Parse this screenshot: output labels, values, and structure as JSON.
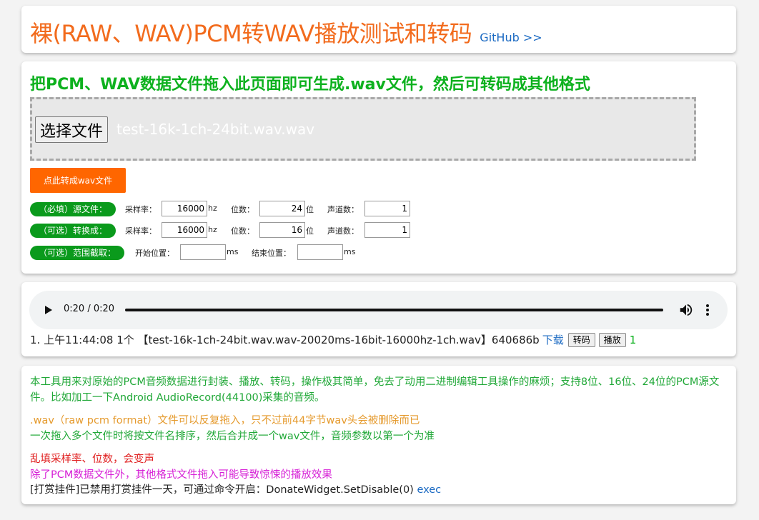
{
  "header": {
    "title": "裸(RAW、WAV)PCM转WAV播放测试和转码",
    "github_link": "GitHub >>"
  },
  "dropzone": {
    "heading": "把PCM、WAV数据文件拖入此页面即可生成.wav文件，然后可转码成其他格式",
    "file_button_label": "选择文件",
    "file_name": "test-16k-1ch-24bit.wav.wav"
  },
  "convert_button_label": "点此转成wav文件",
  "params": {
    "source": {
      "label": "（必填）源文件：",
      "sample_rate_label": "采样率：",
      "sample_rate": "16000",
      "hz": "hz",
      "bits_label": "位数：",
      "bits": "24",
      "bits_unit": "位",
      "channels_label": "声道数：",
      "channels": "1"
    },
    "target": {
      "label": "（可选）转换成：",
      "sample_rate_label": "采样率：",
      "sample_rate": "16000",
      "hz": "hz",
      "bits_label": "位数：",
      "bits": "16",
      "bits_unit": "位",
      "channels_label": "声道数：",
      "channels": "1"
    },
    "range": {
      "label": "（可选）范围截取：",
      "start_label": "开始位置：",
      "start": "",
      "start_unit": "ms",
      "end_label": "结束位置：",
      "end": "",
      "end_unit": "ms"
    }
  },
  "player": {
    "time": "0:20 / 0:20",
    "progress": 1.0,
    "icons": [
      "play-icon",
      "volume-icon",
      "more-icon"
    ]
  },
  "entry": {
    "text": "1. 上午11:44:08 1个 【test-16k-1ch-24bit.wav.wav-20020ms-16bit-16000hz-1ch.wav】640686b",
    "download_label": "下载",
    "transcode_label": "转码",
    "play_label": "播放",
    "count": "1"
  },
  "info": {
    "p1": "本工具用来对原始的PCM音频数据进行封装、播放、转码，操作极其简单，免去了动用二进制编辑工具操作的麻烦；支持8位、16位、24位的PCM源文件。比如加工一下Android AudioRecord(44100)采集的音频。",
    "p2": ".wav（raw pcm format）文件可以反复拖入，只不过前44字节wav头会被删除而已",
    "p3": "一次拖入多个文件时将按文件名排序，然后合并成一个wav文件，音频参数以第一个为准",
    "p4": "乱填采样率、位数，会变声",
    "p5": "除了PCM数据文件外，其他格式文件拖入可能导致惊悚的播放效果",
    "p6": "[打赏挂件]已禁用打赏挂件一天，可通过命令开启：DonateWidget.SetDisable(0)",
    "exec_label": "exec"
  },
  "colors": {
    "title": "#f26b1d",
    "heading": "#0db11e",
    "accent_button": "#ff6600",
    "pill": "#0a9a1c",
    "link": "#1a69c2"
  }
}
